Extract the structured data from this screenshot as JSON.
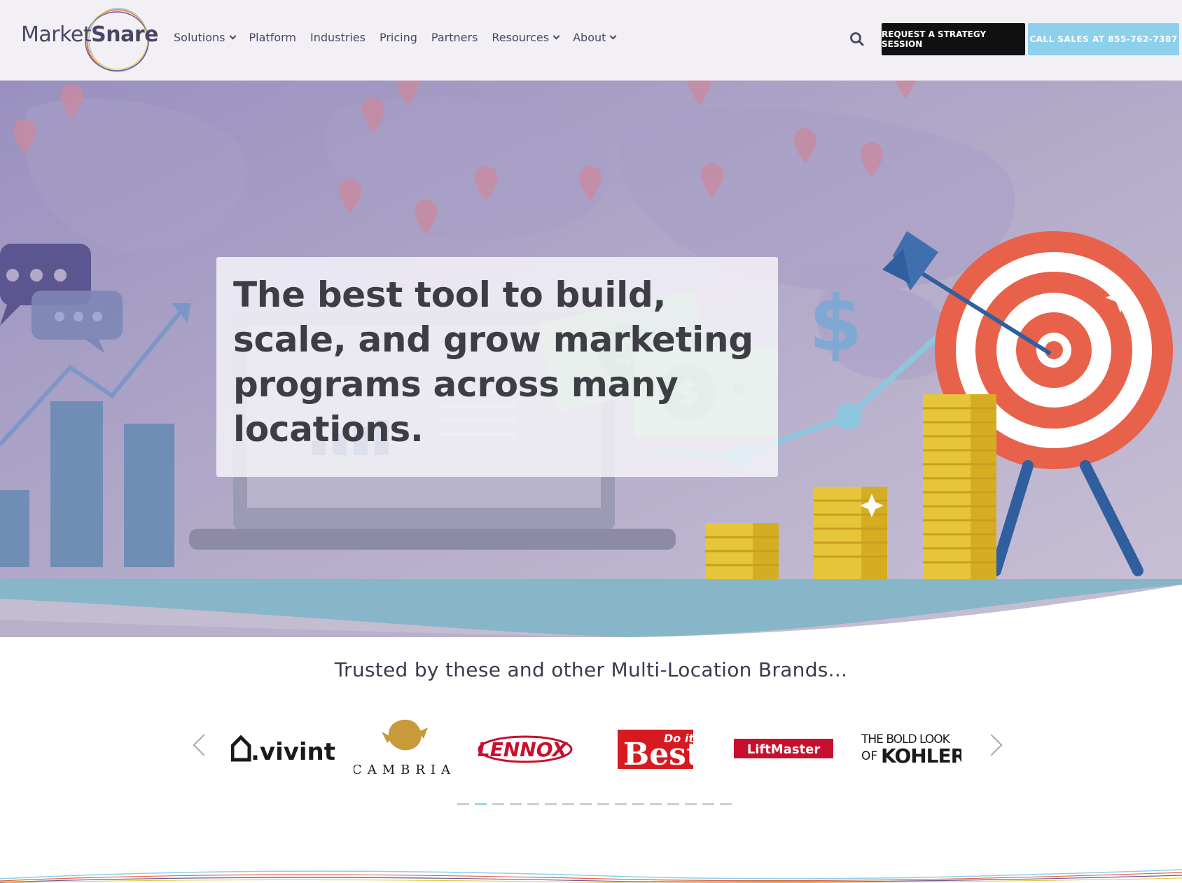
{
  "header": {
    "logo_market": "Market",
    "logo_snare": "Snare",
    "nav": [
      {
        "label": "Solutions",
        "dropdown": true
      },
      {
        "label": "Platform",
        "dropdown": false
      },
      {
        "label": "Industries",
        "dropdown": false
      },
      {
        "label": "Pricing",
        "dropdown": false
      },
      {
        "label": "Partners",
        "dropdown": false
      },
      {
        "label": "Resources",
        "dropdown": true
      },
      {
        "label": "About",
        "dropdown": true
      }
    ],
    "cta_strategy": "REQUEST A STRATEGY SESSION",
    "cta_call": "CALL SALES AT 855-762-7387"
  },
  "hero": {
    "headline": "The best tool to build, scale, and grow marketing programs across many locations."
  },
  "trusted": {
    "title": "Trusted by these and other Multi-Location Brands...",
    "brands": [
      {
        "name": "vivint",
        "text": ".vivint"
      },
      {
        "name": "cambria",
        "text": "CAMBRIA"
      },
      {
        "name": "lennox",
        "text": "LENNOX"
      },
      {
        "name": "do-it-best",
        "text_top": "Do it",
        "text_main": "Best"
      },
      {
        "name": "liftmaster",
        "text": "LiftMaster"
      },
      {
        "name": "kohler",
        "text_top": "THE BOLD LOOK",
        "text_of": "OF",
        "text_main": "KOHLER"
      }
    ],
    "dots_count": 16,
    "active_dot": 1
  },
  "colors": {
    "header_bg": "#f2f0f5",
    "nav_text": "#4b4563",
    "cta_dark": "#111111",
    "cta_light": "#8dd0ec",
    "hero_purple": "#9b93bd",
    "target_red": "#e8614a",
    "coin_yellow": "#e7c53a"
  }
}
